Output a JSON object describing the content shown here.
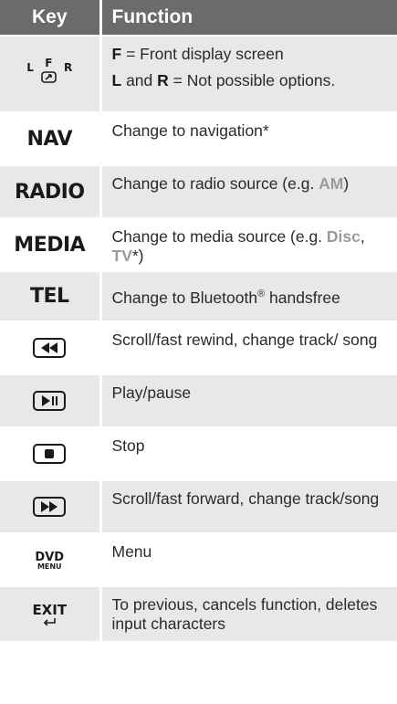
{
  "header": {
    "key": "Key",
    "function": "Function"
  },
  "rows": [
    {
      "icon": "front-rear-select-icon",
      "icon_letters": {
        "left": "L",
        "front": "F",
        "right": "R"
      },
      "line1": {
        "bold": "F",
        "text": " = Front display screen"
      },
      "line2": {
        "bold1": "L",
        "mid": " and ",
        "bold2": "R",
        "text": " = Not possible options."
      }
    },
    {
      "key_text": "NAV",
      "function": "Change to navigation*"
    },
    {
      "key_text": "RADIO",
      "function_pre": "Change to radio source (e.g. ",
      "hl1": "AM",
      "function_post": ")"
    },
    {
      "key_text": "MEDIA",
      "function_pre": "Change to media source (e.g. ",
      "hl1": "Disc",
      "sep": ", ",
      "hl2": "TV",
      "function_post": "*)"
    },
    {
      "key_text": "TEL",
      "function_pre": "Change to Bluetooth",
      "sup": "®",
      "function_post": " handsfree"
    },
    {
      "icon": "rewind-button-icon",
      "function": "Scroll/fast rewind, change track/ song"
    },
    {
      "icon": "play-pause-button-icon",
      "function": "Play/pause"
    },
    {
      "icon": "stop-button-icon",
      "function": "Stop"
    },
    {
      "icon": "fast-forward-button-icon",
      "function": "Scroll/fast forward, change track/song"
    },
    {
      "key_top": "DVD",
      "key_bottom": "MENU",
      "function": "Menu"
    },
    {
      "key_text": "EXIT",
      "icon": "back-arrow-icon",
      "function": "To previous, cancels function, deletes input characters"
    }
  ],
  "colors": {
    "header": "#6b6b6b",
    "row_shade": "#e8e8e8",
    "highlight": "#9a9a9a"
  }
}
